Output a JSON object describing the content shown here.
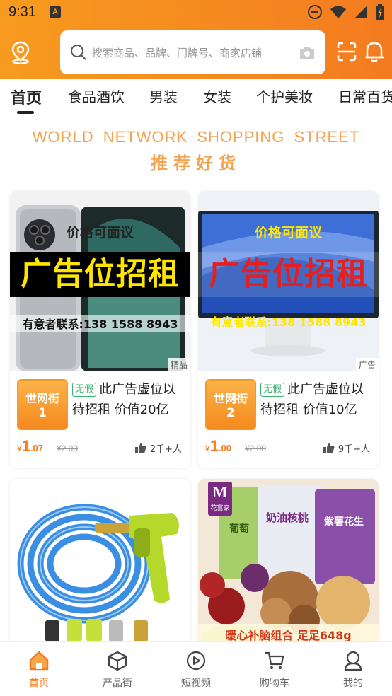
{
  "status_bar": {
    "time": "9:31",
    "notification_letter": "A"
  },
  "header": {
    "search_placeholder": "搜索商品、品牌、门牌号、商家店铺",
    "icons": [
      "location-icon",
      "search-icon",
      "camera-icon",
      "scan-icon",
      "bell-icon"
    ]
  },
  "tabs": [
    "首页",
    "食品酒饮",
    "男装",
    "女装",
    "个护美妆",
    "日常百货"
  ],
  "banner": {
    "english": "WORLD NETWORK SHOPPING STREET",
    "chinese": "推荐好货"
  },
  "products": [
    {
      "image_text": {
        "line1": "价格可面议",
        "big": "广告位招租",
        "line2": "有意者联系:138 1588 8943",
        "corner_tag": "精品"
      },
      "badge": {
        "name": "世网街",
        "number": "1"
      },
      "tag": "无假",
      "title": "此广告虚位以待招租 价值20亿",
      "price": {
        "currency": "¥",
        "integer": "1",
        "decimal": ".07",
        "original": "¥2.00"
      },
      "likes": "2千+人"
    },
    {
      "image_text": {
        "line1": "价格可面议",
        "big": "广告位招租",
        "line2": "有意者联系:138 1588 8943",
        "corner_tag": "广告"
      },
      "badge": {
        "name": "世网街",
        "number": "2"
      },
      "tag": "无假",
      "title": "此广告虚位以待招租 价值10亿",
      "price": {
        "currency": "¥",
        "integer": "1",
        "decimal": ".00",
        "original": "¥2.00"
      },
      "likes": "9千+人"
    },
    {
      "image_text": {
        "caption": ""
      }
    },
    {
      "image_text": {
        "brand": "花富家",
        "labels": [
          "葡萄",
          "奶油核桃",
          "紫薯花生"
        ],
        "caption": "暖心补脑组合 足足648g"
      }
    }
  ],
  "bottom_nav": [
    {
      "label": "首页",
      "icon": "home-icon",
      "active": true
    },
    {
      "label": "产品街",
      "icon": "box-icon",
      "active": false
    },
    {
      "label": "短视频",
      "icon": "play-icon",
      "active": false
    },
    {
      "label": "购物车",
      "icon": "cart-icon",
      "active": false
    },
    {
      "label": "我的",
      "icon": "user-icon",
      "active": false
    }
  ],
  "colors": {
    "accent": "#f47b20",
    "ad_red": "#e41f1f",
    "ad_yellow": "#ffe600"
  }
}
